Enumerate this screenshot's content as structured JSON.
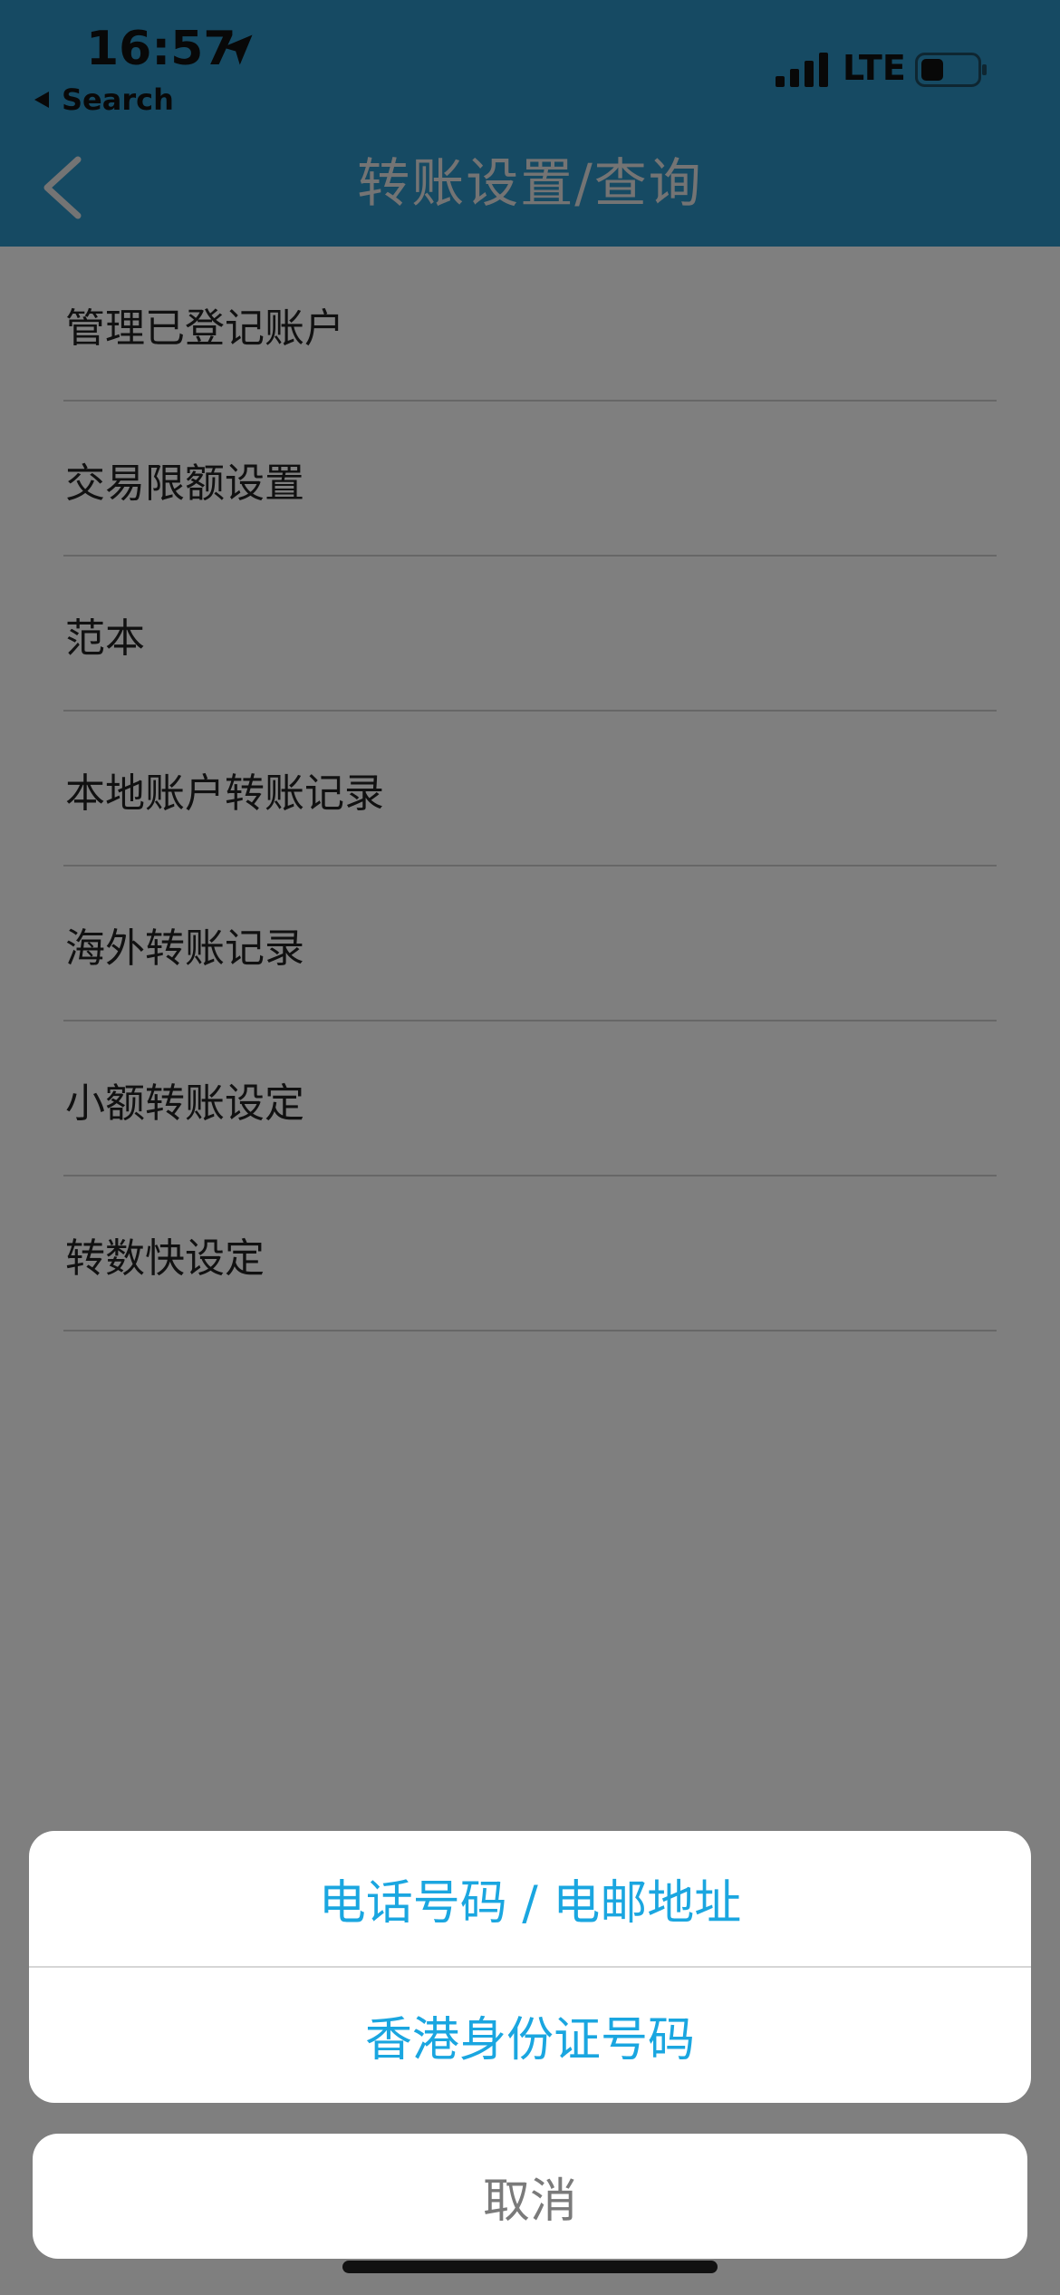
{
  "status_bar": {
    "time": "16:57",
    "back_app": "Search",
    "network": "LTE"
  },
  "nav": {
    "title": "转账设置/查询"
  },
  "list": {
    "items": [
      {
        "label": "管理已登记账户"
      },
      {
        "label": "交易限额设置"
      },
      {
        "label": "范本"
      },
      {
        "label": "本地账户转账记录"
      },
      {
        "label": "海外转账记录"
      },
      {
        "label": "小额转账设定"
      },
      {
        "label": "转数快设定"
      }
    ]
  },
  "action_sheet": {
    "options": [
      {
        "label": "电话号码 / 电邮地址"
      },
      {
        "label": "香港身份证号码"
      }
    ],
    "cancel_label": "取消"
  },
  "colors": {
    "header_bg": "#2c94c7",
    "accent": "#1aa6e0",
    "overlay": "rgba(0,0,0,0.5)"
  }
}
